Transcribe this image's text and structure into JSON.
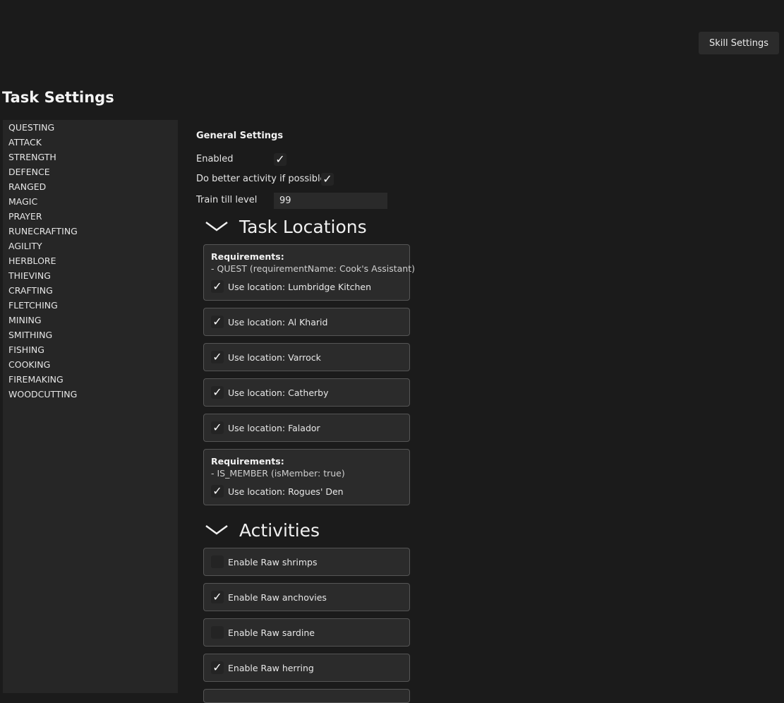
{
  "header": {
    "skill_settings_label": "Skill Settings"
  },
  "page_title": "Task Settings",
  "sidebar": {
    "items": [
      "QUESTING",
      "ATTACK",
      "STRENGTH",
      "DEFENCE",
      "RANGED",
      "MAGIC",
      "PRAYER",
      "RUNECRAFTING",
      "AGILITY",
      "HERBLORE",
      "THIEVING",
      "CRAFTING",
      "FLETCHING",
      "MINING",
      "SMITHING",
      "FISHING",
      "COOKING",
      "FIREMAKING",
      "WOODCUTTING"
    ]
  },
  "general": {
    "title": "General Settings",
    "enabled_label": "Enabled",
    "enabled_checked": true,
    "better_activity_label": "Do better activity if possible",
    "better_activity_checked": true,
    "train_till_label": "Train till level",
    "train_till_value": "99"
  },
  "locations": {
    "title": "Task Locations",
    "cards": [
      {
        "req_title": "Requirements:",
        "req_line": "- QUEST (requirementName: Cook's Assistant)",
        "label": "Use location: Lumbridge Kitchen",
        "checked": true
      },
      {
        "label": "Use location: Al Kharid",
        "checked": true
      },
      {
        "label": "Use location: Varrock",
        "checked": true
      },
      {
        "label": "Use location: Catherby",
        "checked": true
      },
      {
        "label": "Use location: Falador",
        "checked": true
      },
      {
        "req_title": "Requirements:",
        "req_line": "- IS_MEMBER (isMember: true)",
        "label": "Use location: Rogues' Den",
        "checked": true
      }
    ]
  },
  "activities": {
    "title": "Activities",
    "cards": [
      {
        "label": "Enable Raw shrimps",
        "checked": false
      },
      {
        "label": "Enable Raw anchovies",
        "checked": true
      },
      {
        "label": "Enable Raw sardine",
        "checked": false
      },
      {
        "label": "Enable Raw herring",
        "checked": true
      }
    ]
  },
  "icons": {
    "check": "check-icon",
    "chevron": "chevron-down-icon"
  }
}
